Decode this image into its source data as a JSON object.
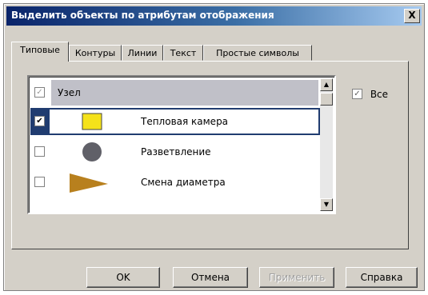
{
  "window": {
    "title": "Выделить объекты по атрибутам отображения",
    "close_label": "X"
  },
  "tabs": [
    {
      "label": "Типовые",
      "active": true
    },
    {
      "label": "Контуры",
      "active": false
    },
    {
      "label": "Линии",
      "active": false
    },
    {
      "label": "Текст",
      "active": false
    },
    {
      "label": "Простые символы",
      "active": false
    }
  ],
  "list": {
    "rows": [
      {
        "label": "Узел",
        "checked": true,
        "check_glyph": "✓",
        "symbol": "none",
        "header": true
      },
      {
        "label": "Тепловая камера",
        "checked": true,
        "check_glyph": "✔",
        "symbol": "yellow-square-icon",
        "selected": true
      },
      {
        "label": "Разветвление",
        "checked": false,
        "check_glyph": "",
        "symbol": "gray-circle-icon"
      },
      {
        "label": "Смена диаметра",
        "checked": false,
        "check_glyph": "",
        "symbol": "brown-triangle-icon"
      }
    ]
  },
  "all_checkbox": {
    "label": "Все",
    "checked": true,
    "glyph": "✓"
  },
  "buttons": {
    "ok": "OK",
    "cancel": "Отмена",
    "apply": "Применить",
    "help": "Справка"
  },
  "colors": {
    "title_bar": "#0a246a",
    "selection": "#203c70",
    "yellow_symbol": "#f5e21a",
    "gray_symbol": "#606068",
    "brown_symbol": "#b8801e"
  }
}
